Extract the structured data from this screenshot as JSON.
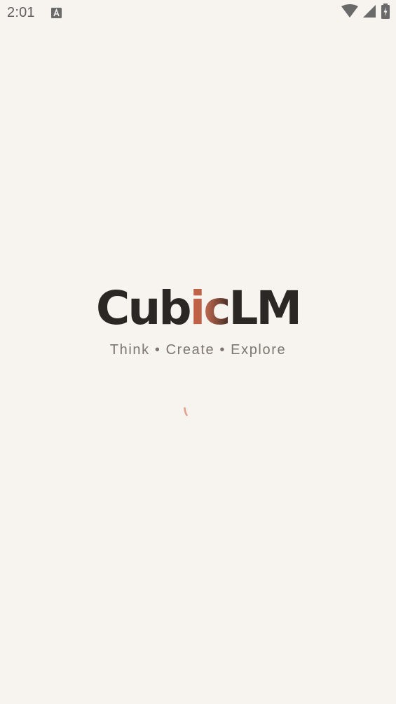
{
  "status_bar": {
    "time": "2:01",
    "notification_icon": "font-a-icon",
    "icons": [
      "wifi-icon",
      "cellular-signal-icon",
      "battery-charging-icon"
    ]
  },
  "splash": {
    "logo_part1": "Cub",
    "logo_accent": "ic",
    "logo_part2": "LM",
    "tagline": "Think • Create • Explore",
    "accent_color": "#c75f44",
    "text_color": "#2b2724"
  },
  "loader": {
    "icon": "loading-spinner-icon",
    "color": "#e2a28c"
  }
}
